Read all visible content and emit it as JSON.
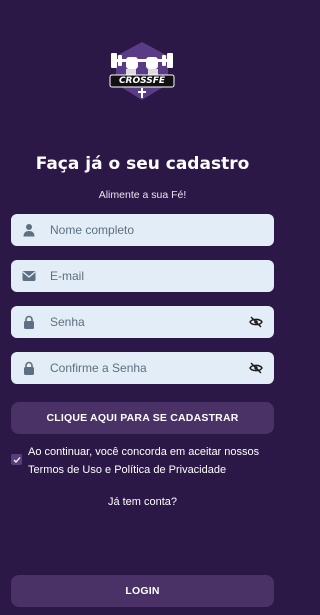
{
  "logo": {
    "text": "CROSSFÉ"
  },
  "header": {
    "title": "Faça já o seu cadastro",
    "subtitle": "Alimente a sua Fé!"
  },
  "form": {
    "fields": [
      {
        "placeholder": "Nome completo",
        "icon": "user-icon"
      },
      {
        "placeholder": "E-mail",
        "icon": "mail-icon"
      },
      {
        "placeholder": "Senha",
        "icon": "lock-icon",
        "toggle_icon": "eye-off-icon"
      },
      {
        "placeholder": "Confirme a Senha",
        "icon": "lock-icon",
        "toggle_icon": "eye-off-icon"
      }
    ],
    "submit_label": "CLIQUE AQUI PARA SE CADASTRAR"
  },
  "terms": {
    "checked": true,
    "line1": "Ao continuar, você concorda em aceitar nossos",
    "line2": "Termos de Uso e Política de Privacidade"
  },
  "login": {
    "prompt": "Já tem conta?",
    "button_label": "LOGIN"
  },
  "colors": {
    "background": "#2c1846",
    "input_bg": "#e3edf7",
    "button_bg": "#4a3266",
    "icon": "#5d6f80"
  }
}
